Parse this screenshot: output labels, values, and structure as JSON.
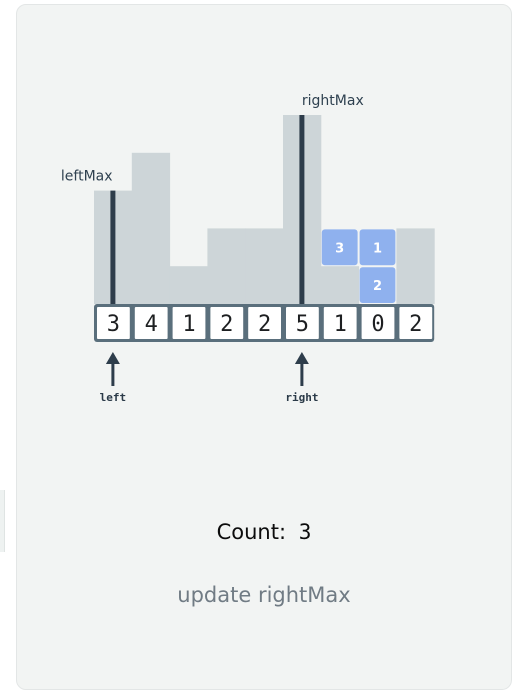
{
  "array": {
    "values": [
      3,
      4,
      1,
      2,
      2,
      5,
      1,
      0,
      2
    ]
  },
  "water_blocks": [
    {
      "column": 6,
      "level": 2,
      "label": "3"
    },
    {
      "column": 7,
      "level": 2,
      "label": "1"
    },
    {
      "column": 7,
      "level": 1,
      "label": "2"
    }
  ],
  "markers": {
    "left_max": {
      "label": "leftMax",
      "index": 0
    },
    "right_max": {
      "label": "rightMax",
      "index": 5
    }
  },
  "pointers": {
    "left": {
      "label": "left",
      "index": 0
    },
    "right": {
      "label": "right",
      "index": 5
    }
  },
  "count": {
    "label": "Count:",
    "value": "3"
  },
  "status": "update rightMax",
  "colors": {
    "bar": "#cdd5d8",
    "water": "#8fb1ee",
    "cell_border": "#5a6f7c",
    "marker_line": "#2e3d4b",
    "panel_bg": "#f2f4f3"
  }
}
